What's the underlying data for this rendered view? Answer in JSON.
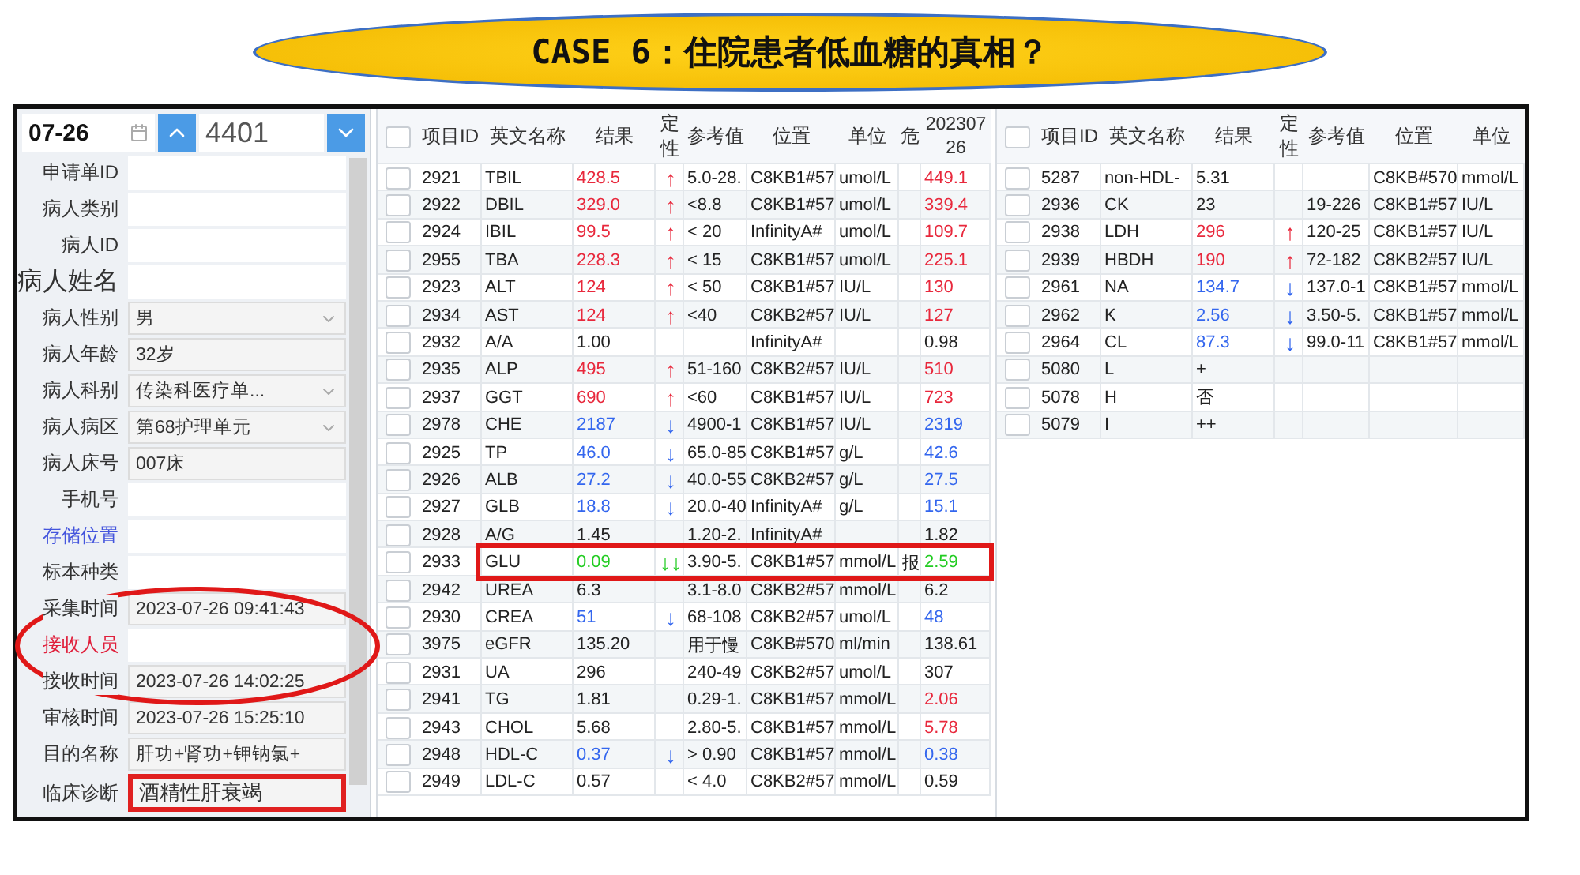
{
  "title": "CASE 6：住院患者低血糖的真相？",
  "toolbar": {
    "date": "07-26",
    "sample_number": "4401"
  },
  "fields": [
    {
      "label": "申请单ID",
      "color": "#333333",
      "large": false,
      "kind": "input",
      "highlighted": false
    },
    {
      "label": "病人类别",
      "color": "#333333",
      "large": false,
      "kind": "input",
      "highlighted": false
    },
    {
      "label": "病人ID",
      "color": "#333333",
      "large": false,
      "kind": "input",
      "highlighted": false
    },
    {
      "label": "病人姓名",
      "color": "#333333",
      "large": true,
      "kind": "input",
      "highlighted": false
    },
    {
      "label": "病人性别",
      "color": "#333333",
      "large": false,
      "kind": "select",
      "value": "男",
      "highlighted": false
    },
    {
      "label": "病人年龄",
      "color": "#333333",
      "large": false,
      "kind": "readonly",
      "value": "32岁",
      "highlighted": false
    },
    {
      "label": "病人科别",
      "color": "#333333",
      "large": false,
      "kind": "select",
      "value": "传染科医疗单...",
      "highlighted": false
    },
    {
      "label": "病人病区",
      "color": "#333333",
      "large": false,
      "kind": "select",
      "value": "第68护理单元",
      "highlighted": false
    },
    {
      "label": "病人床号",
      "color": "#333333",
      "large": false,
      "kind": "readonly",
      "value": "007床",
      "highlighted": false
    },
    {
      "label": "手机号",
      "color": "#333333",
      "large": false,
      "kind": "input",
      "highlighted": false
    },
    {
      "label": "存储位置",
      "color": "#4455dd",
      "large": false,
      "kind": "input",
      "highlighted": false
    },
    {
      "label": "标本种类",
      "color": "#333333",
      "large": false,
      "kind": "input",
      "highlighted": false
    },
    {
      "label": "采集时间",
      "color": "#333333",
      "large": false,
      "kind": "readonly",
      "value": "2023-07-26 09:41:43",
      "highlighted": false
    },
    {
      "label": "接收人员",
      "color": "#e0203c",
      "large": false,
      "kind": "input",
      "highlighted": false
    },
    {
      "label": "接收时间",
      "color": "#333333",
      "large": false,
      "kind": "readonly",
      "value": "2023-07-26 14:02:25",
      "highlighted": false
    },
    {
      "label": "审核时间",
      "color": "#333333",
      "large": false,
      "kind": "readonly",
      "value": "2023-07-26 15:25:10",
      "highlighted": false
    },
    {
      "label": "目的名称",
      "color": "#333333",
      "large": false,
      "kind": "readonly",
      "value": "肝功+肾功+钾钠氯+",
      "highlighted": false
    },
    {
      "label": "临床诊断",
      "color": "#333333",
      "large": false,
      "kind": "textarea",
      "value": "酒精性肝衰竭",
      "highlighted": true
    }
  ],
  "annotations": [
    {
      "kind": "ellipse"
    }
  ],
  "tables": [
    {
      "all_checked": false,
      "columns": [
        "项目ID",
        "英文名称",
        "结果",
        "定性",
        "参考值",
        "位置",
        "单位",
        "危",
        "20230726"
      ],
      "rows": [
        {
          "id": "2921",
          "name": "TBIL",
          "result": "428.5",
          "color": "#e8283c",
          "flag": "↑",
          "ref": "5.0-28.",
          "location": "C8KB1#57",
          "unit": "umol/L",
          "prev": {
            "text": "449.1",
            "color": "#e8283c"
          },
          "checked": false,
          "highlighted": false
        },
        {
          "id": "2922",
          "name": "DBIL",
          "result": "329.0",
          "color": "#e8283c",
          "flag": "↑",
          "ref": "<8.8",
          "location": "C8KB1#57",
          "unit": "umol/L",
          "prev": {
            "text": "339.4",
            "color": "#e8283c"
          },
          "checked": false,
          "highlighted": false
        },
        {
          "id": "2924",
          "name": "IBIL",
          "result": "99.5",
          "color": "#e8283c",
          "flag": "↑",
          "ref": "< 20",
          "location": "InfinityA#",
          "unit": "umol/L",
          "prev": {
            "text": "109.7",
            "color": "#e8283c"
          },
          "checked": false,
          "highlighted": false
        },
        {
          "id": "2955",
          "name": "TBA",
          "result": "228.3",
          "color": "#e8283c",
          "flag": "↑",
          "ref": "< 15",
          "location": "C8KB1#57",
          "unit": "umol/L",
          "prev": {
            "text": "225.1",
            "color": "#e8283c"
          },
          "checked": false,
          "highlighted": false
        },
        {
          "id": "2923",
          "name": "ALT",
          "result": "124",
          "color": "#e8283c",
          "flag": "↑",
          "ref": "< 50",
          "location": "C8KB1#57",
          "unit": "IU/L",
          "prev": {
            "text": "130",
            "color": "#e8283c"
          },
          "checked": false,
          "highlighted": false
        },
        {
          "id": "2934",
          "name": "AST",
          "result": "124",
          "color": "#e8283c",
          "flag": "↑",
          "ref": "<40",
          "location": "C8KB2#57",
          "unit": "IU/L",
          "prev": {
            "text": "127",
            "color": "#e8283c"
          },
          "checked": false,
          "highlighted": false
        },
        {
          "id": "2932",
          "name": "A/A",
          "result": "1.00",
          "color": "#222222",
          "location": "InfinityA#",
          "prev": {
            "text": "0.98",
            "color": "#222222"
          },
          "checked": false,
          "highlighted": false
        },
        {
          "id": "2935",
          "name": "ALP",
          "result": "495",
          "color": "#e8283c",
          "flag": "↑",
          "ref": "51-160",
          "location": "C8KB2#57",
          "unit": "IU/L",
          "prev": {
            "text": "510",
            "color": "#e8283c"
          },
          "checked": false,
          "highlighted": false
        },
        {
          "id": "2937",
          "name": "GGT",
          "result": "690",
          "color": "#e8283c",
          "flag": "↑",
          "ref": "<60",
          "location": "C8KB1#57",
          "unit": "IU/L",
          "prev": {
            "text": "723",
            "color": "#e8283c"
          },
          "checked": false,
          "highlighted": false
        },
        {
          "id": "2978",
          "name": "CHE",
          "result": "2187",
          "color": "#3366ee",
          "flag": "↓",
          "ref": "4900-1",
          "location": "C8KB1#57",
          "unit": "IU/L",
          "prev": {
            "text": "2319",
            "color": "#3366ee"
          },
          "checked": false,
          "highlighted": false
        },
        {
          "id": "2925",
          "name": "TP",
          "result": "46.0",
          "color": "#3366ee",
          "flag": "↓",
          "ref": "65.0-85",
          "location": "C8KB1#57",
          "unit": "g/L",
          "prev": {
            "text": "42.6",
            "color": "#3366ee"
          },
          "checked": false,
          "highlighted": false
        },
        {
          "id": "2926",
          "name": "ALB",
          "result": "27.2",
          "color": "#3366ee",
          "flag": "↓",
          "ref": "40.0-55",
          "location": "C8KB2#57",
          "unit": "g/L",
          "prev": {
            "text": "27.5",
            "color": "#3366ee"
          },
          "checked": false,
          "highlighted": false
        },
        {
          "id": "2927",
          "name": "GLB",
          "result": "18.8",
          "color": "#3366ee",
          "flag": "↓",
          "ref": "20.0-40",
          "location": "InfinityA#",
          "unit": "g/L",
          "prev": {
            "text": "15.1",
            "color": "#3366ee"
          },
          "checked": false,
          "highlighted": false
        },
        {
          "id": "2928",
          "name": "A/G",
          "result": "1.45",
          "color": "#222222",
          "ref": "1.20-2.",
          "location": "InfinityA#",
          "prev": {
            "text": "1.82",
            "color": "#222222"
          },
          "checked": false,
          "highlighted": false
        },
        {
          "id": "2933",
          "name": "GLU",
          "result": "0.09",
          "color": "#22cc22",
          "flag": "↓↓",
          "ref": "3.90-5.",
          "location": "C8KB1#57",
          "unit": "mmol/L",
          "crit": "报",
          "prev": {
            "text": "2.59",
            "color": "#22cc22"
          },
          "checked": false,
          "highlighted": true
        },
        {
          "id": "2942",
          "name": "UREA",
          "result": "6.3",
          "color": "#222222",
          "ref": "3.1-8.0",
          "location": "C8KB2#57",
          "unit": "mmol/L",
          "prev": {
            "text": "6.2",
            "color": "#222222"
          },
          "checked": false,
          "highlighted": false
        },
        {
          "id": "2930",
          "name": "CREA",
          "result": "51",
          "color": "#3366ee",
          "flag": "↓",
          "ref": "68-108",
          "location": "C8KB2#57",
          "unit": "umol/L",
          "prev": {
            "text": "48",
            "color": "#3366ee"
          },
          "checked": false,
          "highlighted": false
        },
        {
          "id": "3975",
          "name": "eGFR",
          "result": "135.20",
          "color": "#222222",
          "ref": "用于慢",
          "location": "C8KB#570",
          "unit": "ml/min",
          "prev": {
            "text": "138.61",
            "color": "#222222"
          },
          "checked": false,
          "highlighted": false
        },
        {
          "id": "2931",
          "name": "UA",
          "result": "296",
          "color": "#222222",
          "ref": "240-49",
          "location": "C8KB2#57",
          "unit": "umol/L",
          "prev": {
            "text": "307",
            "color": "#222222"
          },
          "checked": false,
          "highlighted": false
        },
        {
          "id": "2941",
          "name": "TG",
          "result": "1.81",
          "color": "#222222",
          "ref": "0.29-1.",
          "location": "C8KB1#57",
          "unit": "mmol/L",
          "prev": {
            "text": "2.06",
            "color": "#e8283c"
          },
          "checked": false,
          "highlighted": false
        },
        {
          "id": "2943",
          "name": "CHOL",
          "result": "5.68",
          "color": "#222222",
          "ref": "2.80-5.",
          "location": "C8KB1#57",
          "unit": "mmol/L",
          "prev": {
            "text": "5.78",
            "color": "#e8283c"
          },
          "checked": false,
          "highlighted": false
        },
        {
          "id": "2948",
          "name": "HDL-C",
          "result": "0.37",
          "color": "#3366ee",
          "flag": "↓",
          "ref": "> 0.90",
          "location": "C8KB1#57",
          "unit": "mmol/L",
          "prev": {
            "text": "0.38",
            "color": "#3366ee"
          },
          "checked": false,
          "highlighted": false
        },
        {
          "id": "2949",
          "name": "LDL-C",
          "result": "0.57",
          "color": "#222222",
          "ref": "< 4.0",
          "location": "C8KB2#57",
          "unit": "mmol/L",
          "prev": {
            "text": "0.59",
            "color": "#222222"
          },
          "checked": false,
          "highlighted": false
        }
      ]
    },
    {
      "all_checked": false,
      "columns": [
        "项目ID",
        "英文名称",
        "结果",
        "定性",
        "参考值",
        "位置",
        "单位"
      ],
      "rows": [
        {
          "id": "5287",
          "name": "non-HDL-",
          "result": "5.31",
          "color": "#222222",
          "location": "C8KB#570",
          "unit": "mmol/L",
          "checked": false,
          "highlighted": false
        },
        {
          "id": "2936",
          "name": "CK",
          "result": "23",
          "color": "#222222",
          "ref": "19-226",
          "location": "C8KB1#57",
          "unit": "IU/L",
          "checked": false,
          "highlighted": false
        },
        {
          "id": "2938",
          "name": "LDH",
          "result": "296",
          "color": "#e8283c",
          "flag": "↑",
          "ref": "120-25",
          "location": "C8KB1#57",
          "unit": "IU/L",
          "checked": false,
          "highlighted": false
        },
        {
          "id": "2939",
          "name": "HBDH",
          "result": "190",
          "color": "#e8283c",
          "flag": "↑",
          "ref": "72-182",
          "location": "C8KB2#57",
          "unit": "IU/L",
          "checked": false,
          "highlighted": false
        },
        {
          "id": "2961",
          "name": "NA",
          "result": "134.7",
          "color": "#3366ee",
          "flag": "↓",
          "ref": "137.0-1",
          "location": "C8KB1#57",
          "unit": "mmol/L",
          "checked": false,
          "highlighted": false
        },
        {
          "id": "2962",
          "name": "K",
          "result": "2.56",
          "color": "#3366ee",
          "flag": "↓",
          "ref": "3.50-5.",
          "location": "C8KB1#57",
          "unit": "mmol/L",
          "checked": false,
          "highlighted": false
        },
        {
          "id": "2964",
          "name": "CL",
          "result": "87.3",
          "color": "#3366ee",
          "flag": "↓",
          "ref": "99.0-11",
          "location": "C8KB1#57",
          "unit": "mmol/L",
          "checked": false,
          "highlighted": false
        },
        {
          "id": "5080",
          "name": "L",
          "result": "+",
          "color": "#222222",
          "checked": false,
          "highlighted": false
        },
        {
          "id": "5078",
          "name": "H",
          "result": "否",
          "color": "#222222",
          "checked": false,
          "highlighted": false
        },
        {
          "id": "5079",
          "name": "I",
          "result": "++",
          "color": "#222222",
          "checked": false,
          "highlighted": false
        }
      ]
    }
  ]
}
